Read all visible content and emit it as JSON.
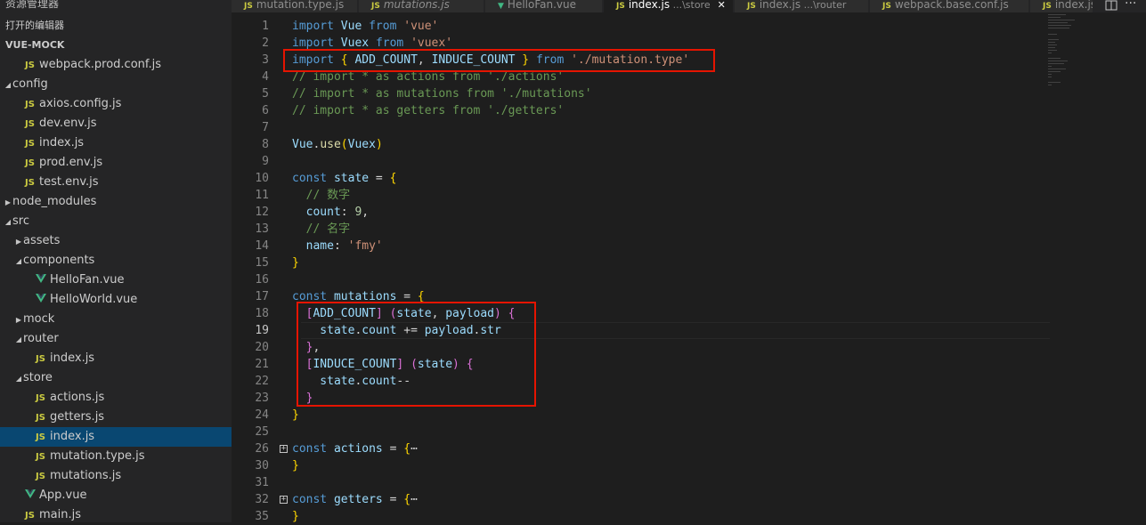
{
  "sidebar": {
    "title": "资源管理器",
    "open_editors": "打开的编辑器",
    "project": "VUE-MOCK",
    "rows": [
      {
        "label": "webpack.prod.conf.js",
        "type": "js",
        "depth": 1
      },
      {
        "label": "config",
        "type": "folder-open",
        "depth": 0
      },
      {
        "label": "axios.config.js",
        "type": "js",
        "depth": 1
      },
      {
        "label": "dev.env.js",
        "type": "js",
        "depth": 1
      },
      {
        "label": "index.js",
        "type": "js",
        "depth": 1
      },
      {
        "label": "prod.env.js",
        "type": "js",
        "depth": 1
      },
      {
        "label": "test.env.js",
        "type": "js",
        "depth": 1
      },
      {
        "label": "node_modules",
        "type": "folder-closed",
        "depth": 0
      },
      {
        "label": "src",
        "type": "folder-open",
        "depth": 0
      },
      {
        "label": "assets",
        "type": "folder-closed",
        "depth": 1
      },
      {
        "label": "components",
        "type": "folder-open",
        "depth": 1
      },
      {
        "label": "HelloFan.vue",
        "type": "vue",
        "depth": 2
      },
      {
        "label": "HelloWorld.vue",
        "type": "vue",
        "depth": 2
      },
      {
        "label": "mock",
        "type": "folder-closed",
        "depth": 1
      },
      {
        "label": "router",
        "type": "folder-open",
        "depth": 1
      },
      {
        "label": "index.js",
        "type": "js",
        "depth": 2
      },
      {
        "label": "store",
        "type": "folder-open",
        "depth": 1
      },
      {
        "label": "actions.js",
        "type": "js",
        "depth": 2
      },
      {
        "label": "getters.js",
        "type": "js",
        "depth": 2
      },
      {
        "label": "index.js",
        "type": "js",
        "depth": 2,
        "active": true
      },
      {
        "label": "mutation.type.js",
        "type": "js",
        "depth": 2
      },
      {
        "label": "mutations.js",
        "type": "js",
        "depth": 2
      },
      {
        "label": "App.vue",
        "type": "vue",
        "depth": 1
      },
      {
        "label": "main.js",
        "type": "js",
        "depth": 1
      }
    ]
  },
  "tabs": [
    {
      "icon": "JS",
      "label": "mutation.type.js",
      "sub": ""
    },
    {
      "icon": "JS",
      "label": "mutations.js",
      "sub": "",
      "italic": true
    },
    {
      "icon": "V",
      "label": "HelloFan.vue",
      "sub": ""
    },
    {
      "icon": "JS",
      "label": "index.js",
      "sub": " ...\\store",
      "active": true,
      "close": "✕"
    },
    {
      "icon": "JS",
      "label": "index.js",
      "sub": " ...\\router"
    },
    {
      "icon": "JS",
      "label": "webpack.base.conf.js",
      "sub": ""
    },
    {
      "icon": "JS",
      "label": "index.js",
      "sub": ""
    }
  ],
  "editor": {
    "current_line": 19,
    "lines": [
      {
        "n": 1,
        "t": [
          [
            "k",
            "import"
          ],
          [
            "v",
            " Vue "
          ],
          [
            "k",
            "from"
          ],
          [
            "s",
            " 'vue'"
          ]
        ]
      },
      {
        "n": 2,
        "t": [
          [
            "k",
            "import"
          ],
          [
            "v",
            " Vuex "
          ],
          [
            "k",
            "from"
          ],
          [
            "s",
            " 'vuex'"
          ]
        ]
      },
      {
        "n": 3,
        "t": [
          [
            "k",
            "import"
          ],
          [
            "y",
            " {"
          ],
          [
            "v",
            " ADD_COUNT"
          ],
          [
            "d",
            ", "
          ],
          [
            "v",
            "INDUCE_COUNT"
          ],
          [
            "y",
            " }"
          ],
          [
            "k",
            " from"
          ],
          [
            "s",
            " './mutation.type'"
          ]
        ]
      },
      {
        "n": 4,
        "t": [
          [
            "c",
            "// import * as actions from './actions'"
          ]
        ]
      },
      {
        "n": 5,
        "t": [
          [
            "c",
            "// import * as mutations from './mutations'"
          ]
        ]
      },
      {
        "n": 6,
        "t": [
          [
            "c",
            "// import * as getters from './getters'"
          ]
        ]
      },
      {
        "n": 7,
        "t": []
      },
      {
        "n": 8,
        "t": [
          [
            "v",
            "Vue"
          ],
          [
            "d",
            "."
          ],
          [
            "f",
            "use"
          ],
          [
            "y",
            "("
          ],
          [
            "v",
            "Vuex"
          ],
          [
            "y",
            ")"
          ]
        ]
      },
      {
        "n": 9,
        "t": []
      },
      {
        "n": 10,
        "t": [
          [
            "k",
            "const"
          ],
          [
            "v",
            " state"
          ],
          [
            "d",
            " = "
          ],
          [
            "y",
            "{"
          ]
        ]
      },
      {
        "n": 11,
        "t": [
          [
            "d",
            "  "
          ],
          [
            "c",
            "// 数字"
          ]
        ]
      },
      {
        "n": 12,
        "t": [
          [
            "v",
            "  count"
          ],
          [
            "d",
            ": "
          ],
          [
            "n",
            "9"
          ],
          [
            "d",
            ","
          ]
        ]
      },
      {
        "n": 13,
        "t": [
          [
            "d",
            "  "
          ],
          [
            "c",
            "// 名字"
          ]
        ]
      },
      {
        "n": 14,
        "t": [
          [
            "v",
            "  name"
          ],
          [
            "d",
            ": "
          ],
          [
            "s",
            "'fmy'"
          ]
        ]
      },
      {
        "n": 15,
        "t": [
          [
            "y",
            "}"
          ]
        ]
      },
      {
        "n": 16,
        "t": []
      },
      {
        "n": 17,
        "t": [
          [
            "k",
            "const"
          ],
          [
            "v",
            " mutations"
          ],
          [
            "d",
            " = "
          ],
          [
            "y",
            "{"
          ]
        ]
      },
      {
        "n": 18,
        "t": [
          [
            "d",
            "  "
          ],
          [
            "p",
            "["
          ],
          [
            "v",
            "ADD_COUNT"
          ],
          [
            "p",
            "]"
          ],
          [
            "d",
            " "
          ],
          [
            "p",
            "("
          ],
          [
            "v",
            "state"
          ],
          [
            "d",
            ", "
          ],
          [
            "v",
            "payload"
          ],
          [
            "p",
            ")"
          ],
          [
            "d",
            " "
          ],
          [
            "p",
            "{"
          ]
        ]
      },
      {
        "n": 19,
        "t": [
          [
            "v",
            "    state"
          ],
          [
            "d",
            "."
          ],
          [
            "v",
            "count"
          ],
          [
            "d",
            " += "
          ],
          [
            "v",
            "payload"
          ],
          [
            "d",
            "."
          ],
          [
            "v",
            "str"
          ]
        ]
      },
      {
        "n": 20,
        "t": [
          [
            "d",
            "  "
          ],
          [
            "p",
            "}"
          ],
          [
            "d",
            ","
          ]
        ]
      },
      {
        "n": 21,
        "t": [
          [
            "d",
            "  "
          ],
          [
            "p",
            "["
          ],
          [
            "v",
            "INDUCE_COUNT"
          ],
          [
            "p",
            "]"
          ],
          [
            "d",
            " "
          ],
          [
            "p",
            "("
          ],
          [
            "v",
            "state"
          ],
          [
            "p",
            ")"
          ],
          [
            "d",
            " "
          ],
          [
            "p",
            "{"
          ]
        ]
      },
      {
        "n": 22,
        "t": [
          [
            "v",
            "    state"
          ],
          [
            "d",
            "."
          ],
          [
            "v",
            "count"
          ],
          [
            "d",
            "--"
          ]
        ]
      },
      {
        "n": 23,
        "t": [
          [
            "d",
            "  "
          ],
          [
            "p",
            "}"
          ]
        ]
      },
      {
        "n": 24,
        "t": [
          [
            "y",
            "}"
          ]
        ]
      },
      {
        "n": 25,
        "t": []
      },
      {
        "n": 26,
        "fold": true,
        "t": [
          [
            "k",
            "const"
          ],
          [
            "v",
            " actions"
          ],
          [
            "d",
            " = "
          ],
          [
            "y",
            "{"
          ],
          [
            "d",
            "⋯"
          ]
        ]
      },
      {
        "n": 30,
        "t": [
          [
            "y",
            "}"
          ]
        ]
      },
      {
        "n": 31,
        "t": []
      },
      {
        "n": 32,
        "fold": true,
        "t": [
          [
            "k",
            "const"
          ],
          [
            "v",
            " getters"
          ],
          [
            "d",
            " = "
          ],
          [
            "y",
            "{"
          ],
          [
            "d",
            "⋯"
          ]
        ]
      },
      {
        "n": 35,
        "t": [
          [
            "y",
            "}"
          ]
        ]
      }
    ]
  }
}
